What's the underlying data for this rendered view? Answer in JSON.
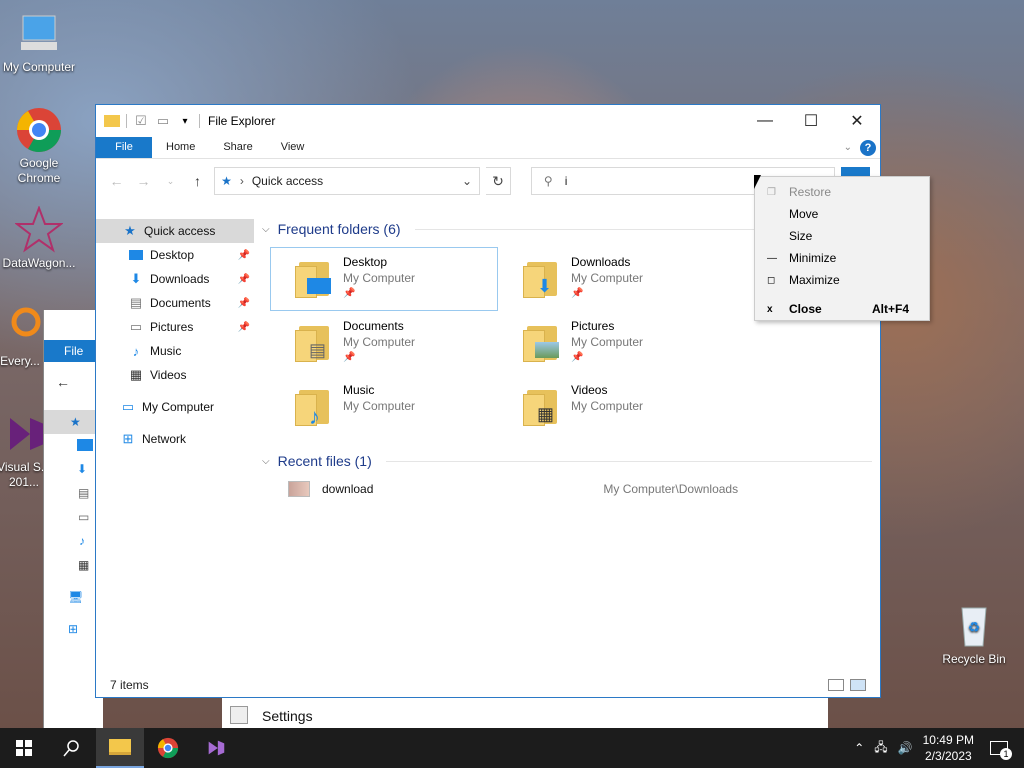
{
  "desktop": {
    "icons": [
      {
        "label": "My Computer"
      },
      {
        "label": "Google Chrome"
      },
      {
        "label": "DataWagon..."
      },
      {
        "label": "Every..."
      },
      {
        "label": "Visual S... 201..."
      },
      {
        "label": "Recycle Bin"
      }
    ]
  },
  "window": {
    "title": "File Explorer",
    "ribbon": {
      "file": "File",
      "home": "Home",
      "share": "Share",
      "view": "View"
    },
    "address": {
      "location": "Quick access"
    },
    "search": {
      "value": "i"
    },
    "nav": [
      {
        "label": "Quick access",
        "icon": "star-icon"
      },
      {
        "label": "Desktop",
        "icon": "desktop-icon"
      },
      {
        "label": "Downloads",
        "icon": "download-icon"
      },
      {
        "label": "Documents",
        "icon": "document-icon"
      },
      {
        "label": "Pictures",
        "icon": "picture-icon"
      },
      {
        "label": "Music",
        "icon": "music-icon"
      },
      {
        "label": "Videos",
        "icon": "video-icon"
      },
      {
        "label": "My Computer",
        "icon": "computer-icon"
      },
      {
        "label": "Network",
        "icon": "network-icon"
      }
    ],
    "frequent": {
      "header": "Frequent folders (6)",
      "folders": [
        {
          "name": "Desktop",
          "sub": "My Computer"
        },
        {
          "name": "Downloads",
          "sub": "My Computer"
        },
        {
          "name": "Documents",
          "sub": "My Computer"
        },
        {
          "name": "Pictures",
          "sub": "My Computer"
        },
        {
          "name": "Music",
          "sub": "My Computer"
        },
        {
          "name": "Videos",
          "sub": "My Computer"
        }
      ]
    },
    "recent": {
      "header": "Recent files (1)",
      "files": [
        {
          "name": "download",
          "path": "My Computer\\Downloads"
        }
      ]
    },
    "status": "7 items"
  },
  "context_menu": {
    "items": [
      {
        "label": "Restore",
        "key": "",
        "disabled": true
      },
      {
        "label": "Move",
        "key": ""
      },
      {
        "label": "Size",
        "key": ""
      },
      {
        "label": "Minimize",
        "key": "—"
      },
      {
        "label": "Maximize",
        "key": "◻"
      },
      {
        "label": "Close",
        "key": "x",
        "accel": "Alt+F4"
      }
    ]
  },
  "background": {
    "ribbon_file": "File",
    "settings_title": "Settings"
  },
  "taskbar": {
    "time": "10:49 PM",
    "date": "2/3/2023",
    "notif_count": "1"
  }
}
